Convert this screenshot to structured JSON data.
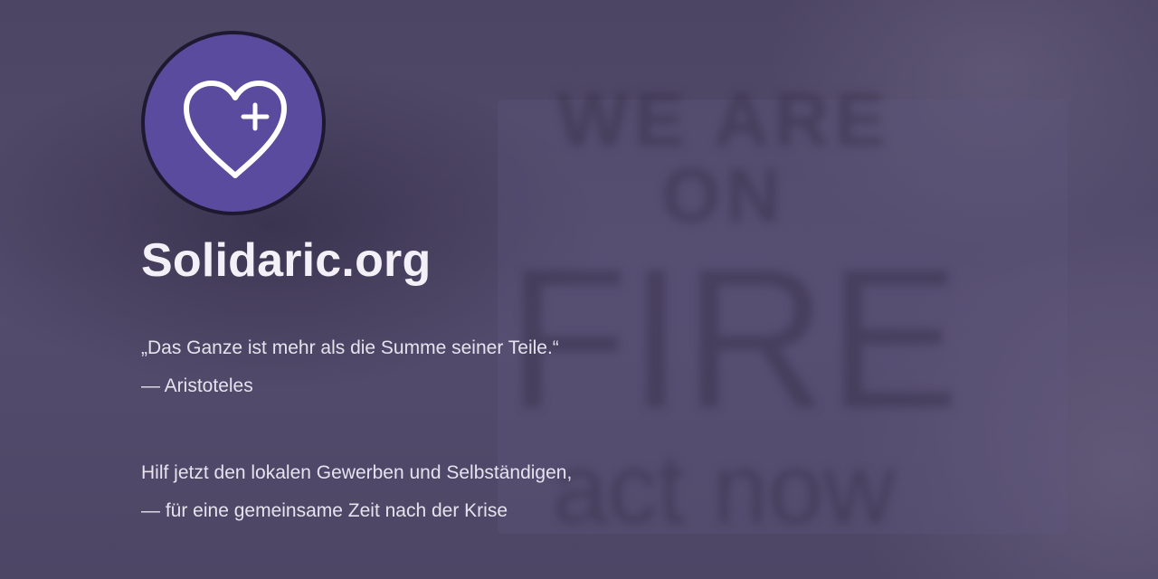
{
  "logo": {
    "icon": "heart-plus-icon",
    "color": "#5b4b9e"
  },
  "title": "Solidaric.org",
  "quote": {
    "text": "„Das Ganze ist mehr als die Summe seiner Teile.“",
    "author": "— Aristoteles"
  },
  "call_to_action": {
    "line1": "Hilf jetzt den lokalen Gewerben und Selbständigen,",
    "line2": "— für eine gemeinsame Zeit nach der Krise"
  },
  "background_sign": {
    "line1": "WE ARE ON",
    "line2": "FIRE",
    "line3": "act now"
  }
}
